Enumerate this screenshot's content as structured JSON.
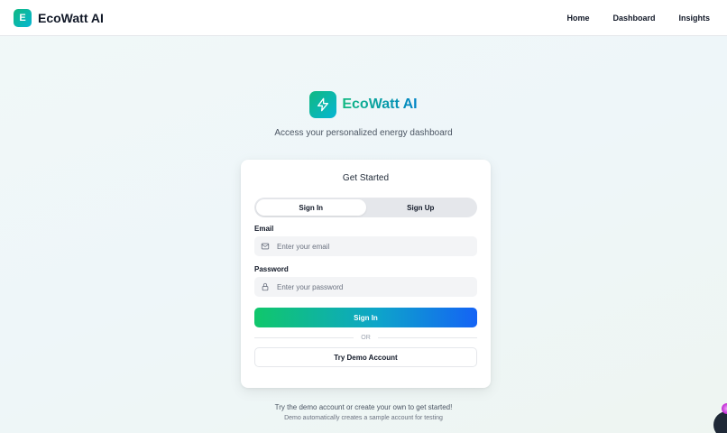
{
  "brand": {
    "badge_letter": "E",
    "name": "EcoWatt AI"
  },
  "nav": {
    "items": [
      "Home",
      "Dashboard",
      "Insights"
    ]
  },
  "hero": {
    "title": "EcoWatt AI",
    "subtitle": "Access your personalized energy dashboard",
    "icon": "lightning-bolt-icon"
  },
  "card": {
    "title": "Get Started",
    "tabs": [
      {
        "label": "Sign In",
        "active": true
      },
      {
        "label": "Sign Up",
        "active": false
      }
    ],
    "email": {
      "label": "Email",
      "placeholder": "Enter your email",
      "value": "",
      "icon": "mail-icon"
    },
    "password": {
      "label": "Password",
      "placeholder": "Enter your password",
      "value": "",
      "icon": "lock-icon"
    },
    "submit_label": "Sign In",
    "divider_text": "OR",
    "demo_label": "Try Demo Account"
  },
  "footer": {
    "line1": "Try the demo account or create your own to get started!",
    "line2": "Demo automatically creates a sample account for testing"
  },
  "colors": {
    "brand_green": "#10b981",
    "brand_cyan": "#06b6d4",
    "button_start": "#10c76b",
    "button_end": "#1463f5"
  }
}
